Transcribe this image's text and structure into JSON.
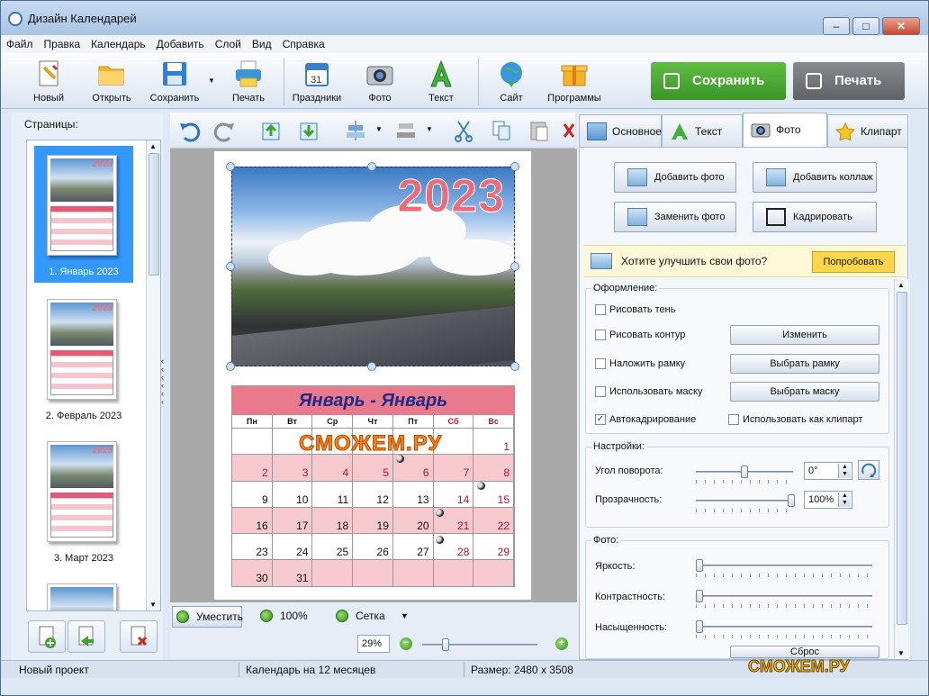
{
  "window": {
    "title": "Дизайн Календарей"
  },
  "menu": [
    "Файл",
    "Правка",
    "Календарь",
    "Добавить",
    "Слой",
    "Вид",
    "Справка"
  ],
  "toolbar": {
    "buttons": [
      {
        "label": "Новый",
        "icon": "new-doc-icon"
      },
      {
        "label": "Открыть",
        "icon": "folder-icon"
      },
      {
        "label": "Сохранить",
        "icon": "floppy-icon"
      },
      {
        "label": "Печать",
        "icon": "printer-icon"
      },
      {
        "label": "Праздники",
        "icon": "calendar-icon"
      },
      {
        "label": "Фото",
        "icon": "camera-icon"
      },
      {
        "label": "Текст",
        "icon": "text-a-icon"
      },
      {
        "label": "Сайт",
        "icon": "globe-icon"
      },
      {
        "label": "Программы",
        "icon": "gift-box-icon"
      }
    ],
    "save_big": "Сохранить",
    "print_big": "Печать"
  },
  "left": {
    "title": "Страницы:",
    "pages": [
      {
        "caption": "1. Январь 2023",
        "selected": true
      },
      {
        "caption": "2. Февраль 2023",
        "selected": false
      },
      {
        "caption": "3. Март 2023",
        "selected": false
      },
      {
        "caption": "",
        "selected": false
      }
    ]
  },
  "canvas": {
    "year": "2023",
    "month_title": "Январь - Январь",
    "watermark": "СМОЖЕМ.РУ",
    "daynames": [
      "Пн",
      "Вт",
      "Ср",
      "Чт",
      "Пт",
      "Сб",
      "Вс"
    ],
    "weeks": [
      [
        "",
        "",
        "",
        "",
        "",
        "",
        "1"
      ],
      [
        "2",
        "3",
        "4",
        "5",
        "6",
        "7",
        "8"
      ],
      [
        "9",
        "10",
        "11",
        "12",
        "13",
        "14",
        "15"
      ],
      [
        "16",
        "17",
        "18",
        "19",
        "20",
        "21",
        "22"
      ],
      [
        "23",
        "24",
        "25",
        "26",
        "27",
        "28",
        "29"
      ],
      [
        "30",
        "31",
        "",
        "",
        "",
        "",
        ""
      ]
    ]
  },
  "zoombar": {
    "fit": "Уместить",
    "full": "100%",
    "grid": "Сетка",
    "zoom": "29%"
  },
  "right": {
    "tabs": [
      "Основное",
      "Текст",
      "Фото",
      "Клипарт"
    ],
    "active_tab": "Фото",
    "add_photo": "Добавить фото",
    "add_collage": "Добавить коллаж",
    "replace_photo": "Заменить фото",
    "crop": "Кадрировать",
    "promo_text": "Хотите улучшить свои фото?",
    "promo_button": "Попробовать",
    "design": {
      "title": "Оформление:",
      "shadow": "Рисовать тень",
      "outline": "Рисовать контур",
      "outline_btn": "Изменить",
      "frame": "Наложить рамку",
      "frame_btn": "Выбрать рамку",
      "mask": "Использовать маску",
      "mask_btn": "Выбрать маску",
      "autocrop": "Автокадрирование",
      "as_clipart": "Использовать как клипарт"
    },
    "settings": {
      "title": "Настройки:",
      "rotation_label": "Угол поворота:",
      "rotation_value": "0°",
      "opacity_label": "Прозрачность:",
      "opacity_value": "100%"
    },
    "photo": {
      "title": "Фото:",
      "brightness": "Яркость:",
      "contrast": "Контрастность:",
      "saturation": "Насыщенность:",
      "reset": "Сброс"
    }
  },
  "status": {
    "project": "Новый проект",
    "calendar": "Календарь на 12 месяцев",
    "size": "Размер: 2480 x 3508"
  },
  "brand": {
    "watermark": "СМОЖЕМ.РУ"
  },
  "colors": {
    "save_green": "#43a12c",
    "print_gray": "#6c6f73",
    "accent_pink": "#e9798d",
    "selection_blue": "#3399ff"
  }
}
